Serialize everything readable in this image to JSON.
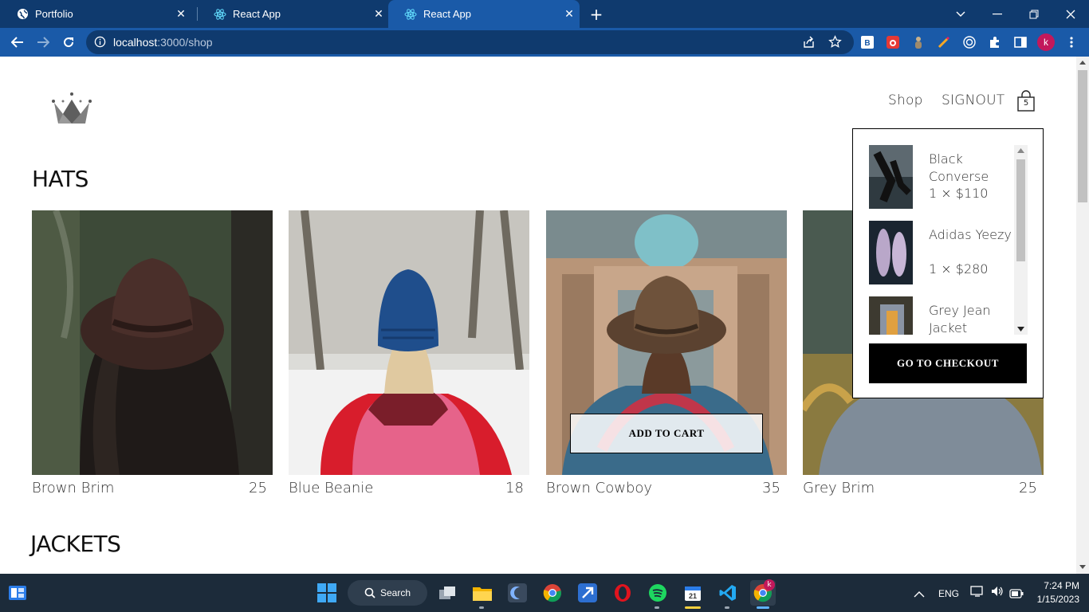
{
  "browser": {
    "tabs": [
      {
        "title": "Portfolio"
      },
      {
        "title": "React App"
      },
      {
        "title": "React App"
      }
    ],
    "new_tab": "+",
    "url_host": "localhost",
    "url_rest": ":3000/shop"
  },
  "header": {
    "nav": {
      "shop": "Shop",
      "signout": "SIGNOUT"
    },
    "cart_count": "5"
  },
  "sections": {
    "hats_title": "HATS",
    "jackets_title": "JACKETS"
  },
  "products": [
    {
      "name": "Brown Brim",
      "price": "25"
    },
    {
      "name": "Blue Beanie",
      "price": "18"
    },
    {
      "name": "Brown Cowboy",
      "price": "35"
    },
    {
      "name": "Grey Brim",
      "price": "25"
    }
  ],
  "add_to_cart": "ADD TO CART",
  "cart": {
    "items": [
      {
        "name": "Black Converse",
        "qty": "1 × $110"
      },
      {
        "name": "Adidas Yeezy",
        "qty": "1 × $280"
      },
      {
        "name": "Grey Jean Jacket",
        "qty": ""
      }
    ],
    "checkout": "GO TO CHECKOUT"
  },
  "taskbar": {
    "search": "Search",
    "lang": "ENG",
    "time": "7:24 PM",
    "date": "1/15/2023",
    "calendar_day": "21"
  },
  "profile_initial": "k"
}
